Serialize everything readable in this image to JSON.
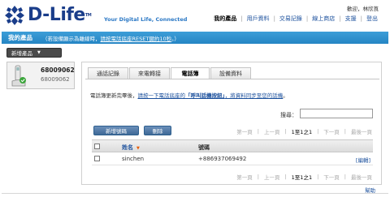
{
  "brand": {
    "name": "D-Life",
    "tm": "TM",
    "tagline": "Your Digital Life, Connected",
    "logo_color": "#1a3d8a",
    "tagline_color": "#2b78c5"
  },
  "header": {
    "welcome": "歡迎，林欣莨",
    "nav": [
      "我的產品",
      "用戶資料",
      "交易記錄",
      "線上商店",
      "支援",
      "登出"
    ],
    "active_nav": "我的產品"
  },
  "bar": {
    "title": "我的產品",
    "hint_prefix": "（若設備顯示為離線時，",
    "hint_link": "請按電話底座RESET鍵約10秒",
    "hint_suffix": "。）",
    "color": "#2585c4"
  },
  "product": {
    "add_button": "新增產品",
    "number": "68009062",
    "id": "68009062"
  },
  "tabs": [
    "通話記錄",
    "來電轉接",
    "電話簿",
    "設備資料"
  ],
  "active_tab": "電話簿",
  "info": {
    "prefix": "電話簿更新完畢後，",
    "link_prefix": "請按一下電話底座的",
    "link_bold": "「呼叫話機按鈕」",
    "link_suffix": "，將資料同步至您的話機",
    "end": "。"
  },
  "search": {
    "label": "搜尋：",
    "placeholder": ""
  },
  "buttons": {
    "new_number": "新增號碼",
    "delete": "刪除"
  },
  "pager": {
    "first": "第一頁",
    "prev": "上一頁",
    "range": "1至1之1",
    "next": "下一頁",
    "last": "最後一頁",
    "sep": "|"
  },
  "table": {
    "columns": {
      "name": "姓名",
      "phone": "號碼"
    },
    "rows": [
      {
        "name": "sinchen",
        "phone": "+886937069492",
        "action": "[編輯]"
      }
    ]
  },
  "help": "幫助"
}
